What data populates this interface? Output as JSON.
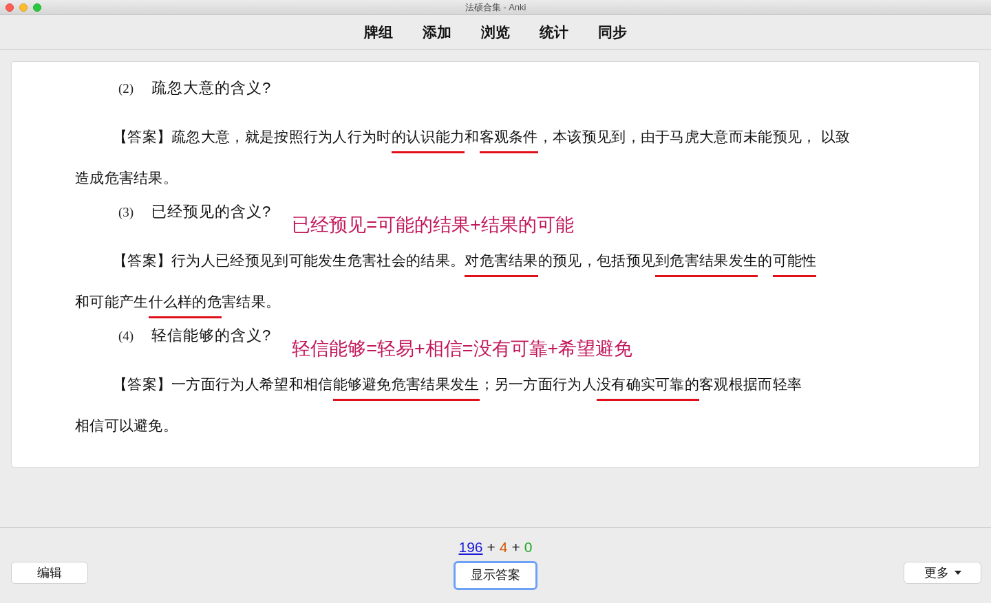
{
  "window": {
    "title": "法硕合集 - Anki"
  },
  "toolbar": [
    {
      "label": "牌组"
    },
    {
      "label": "添加"
    },
    {
      "label": "浏览"
    },
    {
      "label": "统计"
    },
    {
      "label": "同步"
    }
  ],
  "card": {
    "blocks": [
      {
        "number": "(2)",
        "question": "疏忽大意的含义?",
        "answer_lines": [
          [
            {
              "text": "【答案】疏忽大意，就是按照行为人行为时",
              "underlined": false
            },
            {
              "text": "的认识能力",
              "underlined": true
            },
            {
              "text": "和",
              "underlined": false
            },
            {
              "text": "客观条件",
              "underlined": true
            },
            {
              "text": "，本该预见到，由于马虎大意而未能预见， 以致",
              "underlined": false
            }
          ],
          [
            {
              "text": "造成危害结果。",
              "underlined": false
            }
          ]
        ]
      },
      {
        "number": "(3)",
        "question": "已经预见的含义?",
        "note": "已经预见=可能的结果+结果的可能",
        "answer_lines": [
          [
            {
              "text": "【答案】行为人已经预见到可能发生危害社会的结果。",
              "underlined": false
            },
            {
              "text": "对危害结果",
              "underlined": true
            },
            {
              "text": "的预见，包括预见",
              "underlined": false
            },
            {
              "text": "到危害结果发生",
              "underlined": true
            },
            {
              "text": "的",
              "underlined": false
            },
            {
              "text": "可能性",
              "underlined": true
            }
          ],
          [
            {
              "text": "和可能产生",
              "underlined": false
            },
            {
              "text": "什么样的危",
              "underlined": true
            },
            {
              "text": "害结果。",
              "underlined": false
            }
          ]
        ]
      },
      {
        "number": "(4)",
        "question": "轻信能够的含义?",
        "note": "轻信能够=轻易+相信=没有可靠+希望避免",
        "answer_lines": [
          [
            {
              "text": "【答案】一方面行为人希望和相信",
              "underlined": false
            },
            {
              "text": "能够避免危害结果发生",
              "underlined": true
            },
            {
              "text": "；另一方面行为人",
              "underlined": false
            },
            {
              "text": "没有确实可靠的",
              "underlined": true
            },
            {
              "text": "客观根据而轻率",
              "underlined": false
            }
          ],
          [
            {
              "text": "相信可以避免。",
              "underlined": false
            }
          ]
        ]
      }
    ]
  },
  "counts": {
    "new": "196",
    "plus_1": "+",
    "learning": "4",
    "plus_2": "+",
    "review": "0"
  },
  "buttons": {
    "edit": "编辑",
    "show_answer": "显示答案",
    "more": "更多"
  }
}
